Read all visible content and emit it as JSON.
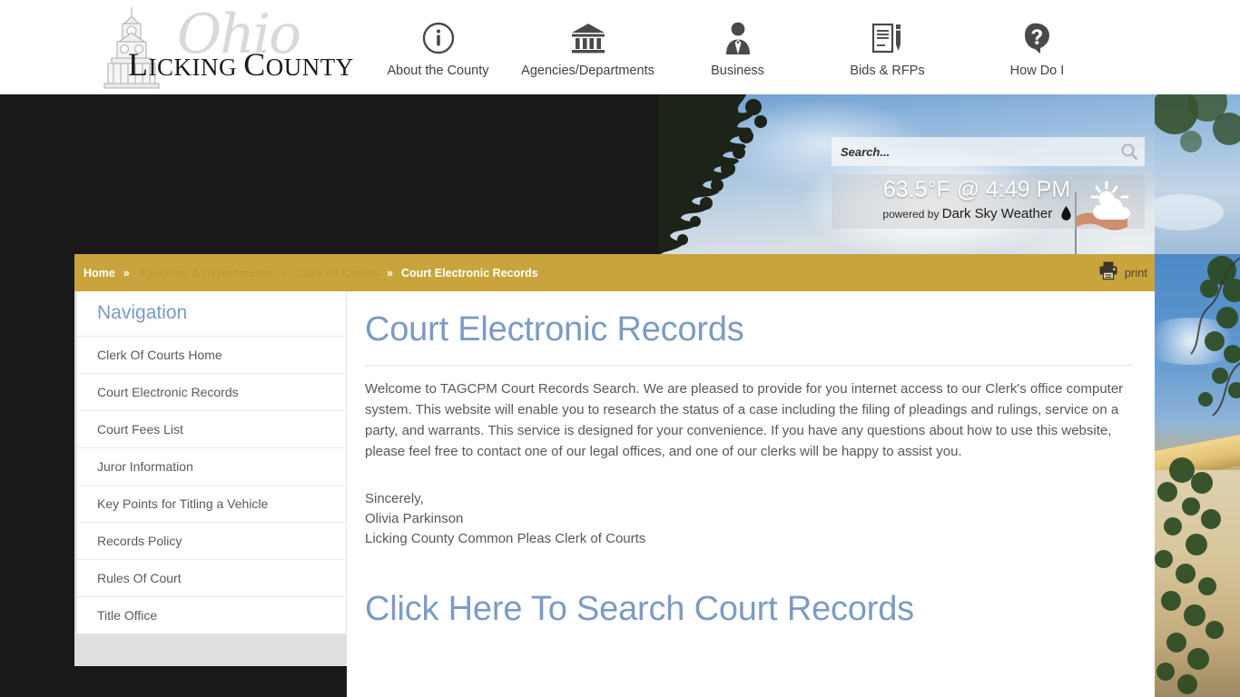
{
  "site": {
    "logo_script": "Ohio",
    "logo_wordmark_1": "L",
    "logo_wordmark_2": "ICKING ",
    "logo_wordmark_3": "C",
    "logo_wordmark_4": "OUNTY"
  },
  "nav": {
    "items": [
      {
        "label": "About the County",
        "icon": "info-circle-icon"
      },
      {
        "label": "Agencies/Departments",
        "icon": "bank-building-icon"
      },
      {
        "label": "Business",
        "icon": "businessman-icon"
      },
      {
        "label": "Bids & RFPs",
        "icon": "document-pen-icon"
      },
      {
        "label": "How Do I",
        "icon": "question-mark-head-icon"
      }
    ]
  },
  "search": {
    "placeholder": "Search...",
    "value": "",
    "icon": "magnifier-icon"
  },
  "weather": {
    "temperature": "63.5°F @ 4:49 PM",
    "powered_prefix": "powered by ",
    "provider": "Dark Sky Weather",
    "drop_icon": "dark-sky-drop-icon",
    "condition_icon": "partly-cloudy-icon"
  },
  "breadcrumb": {
    "items": [
      {
        "label": "Home",
        "state": "link"
      },
      {
        "label": "Agencies & Departments",
        "state": "muted"
      },
      {
        "label": "Clerk Of Courts",
        "state": "muted"
      },
      {
        "label": "Court Electronic Records",
        "state": "current"
      }
    ],
    "separator": "»"
  },
  "print": {
    "label": "print",
    "icon": "printer-icon"
  },
  "sidebar": {
    "title": "Navigation",
    "items": [
      {
        "label": "Clerk Of Courts Home"
      },
      {
        "label": "Court Electronic Records"
      },
      {
        "label": "Court Fees List"
      },
      {
        "label": "Juror Information"
      },
      {
        "label": "Key Points for Titling a Vehicle"
      },
      {
        "label": "Records Policy"
      },
      {
        "label": "Rules Of Court"
      },
      {
        "label": "Title Office"
      }
    ]
  },
  "main": {
    "title": "Court Electronic Records",
    "paragraph": "Welcome to TAGCPM Court Records Search. We are pleased to provide for you internet access to our Clerk's office computer system. This website will enable you to research the status of a case including the filing of pleadings and rulings, service on a party, and warrants. This service is designed for your convenience. If you have any questions about how to use this website, please feel free to contact one of our legal offices, and one of our clerks will be happy to assist you.",
    "signature_line_1": "Sincerely,",
    "signature_line_2": "Olivia Parkinson",
    "signature_line_3": "Licking County Common Pleas Clerk of Courts",
    "cta_label": "Click Here To Search Court Records"
  },
  "colors": {
    "accent_blue": "#7b9bc4",
    "breadcrumb_gold": "#c9a43c",
    "page_dark": "#1a1a1a",
    "body_text": "#585858"
  }
}
